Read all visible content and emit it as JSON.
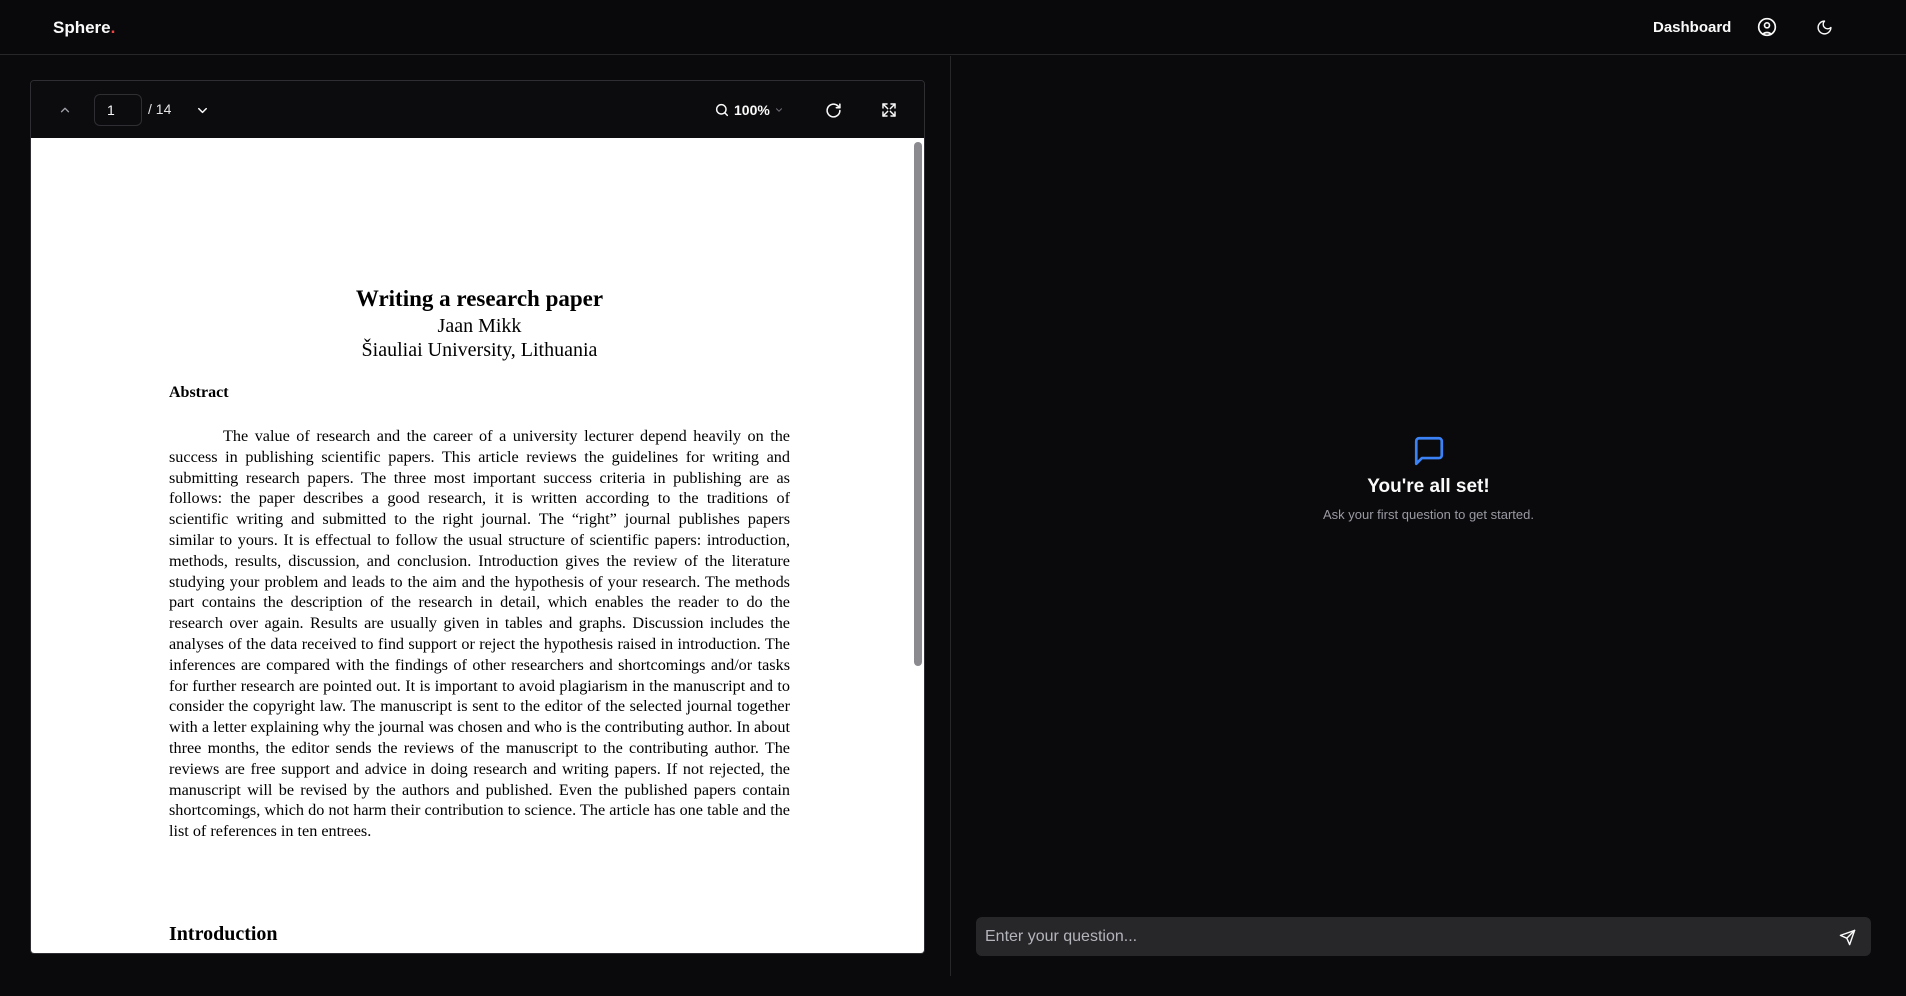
{
  "header": {
    "logo_text": "Sphere",
    "logo_dot": ".",
    "nav_dashboard": "Dashboard",
    "icons": [
      "user-circle-icon",
      "moon-icon"
    ]
  },
  "viewer": {
    "page_current": "1",
    "page_total": "/ 14",
    "zoom": "100%",
    "icons": [
      "chevron-up-icon",
      "chevron-down-icon",
      "search-icon",
      "zoom-dropdown-icon",
      "refresh-icon",
      "fullscreen-icon"
    ],
    "document": {
      "title": "Writing a research paper",
      "author": "Jaan Mikk",
      "affiliation": "Šiauliai University, Lithuania",
      "abstract_heading": "Abstract",
      "abstract_text": "The value of research and the career of a university lecturer depend heavily on the success in publishing scientific papers. This article reviews the guidelines for writing and submitting research papers. The three most important success criteria in publishing are as follows: the paper describes a good research, it is written according to the traditions of scientific writing and submitted to the right journal. The “right” journal publishes papers similar to yours. It is effectual to follow the usual structure of scientific papers: introduction, methods, results, discussion, and conclusion. Introduction gives the review of the literature studying your problem and leads to the aim and the hypothesis of your research. The methods part contains the description of the research in detail, which enables the reader to do the research over again. Results are usually given in tables and graphs. Discussion includes the analyses of the data received to find support or reject the hypothesis raised in introduction. The inferences are compared with the findings of other researchers and shortcomings and/or tasks for further research are pointed out. It is important to avoid plagiarism in the manuscript and to consider the copyright law. The manuscript is sent to the editor of the selected journal together with a letter explaining why the journal was chosen and who is the contributing author. In about three months, the editor sends the reviews of the manuscript to the contributing author. The reviews are free support and advice in doing research and writing papers. If not rejected, the manuscript will be revised by the authors and published. Even the published papers contain shortcomings, which do not harm their contribution to science. The article has one table and the list of references in ten entrees.",
      "intro_heading": "Introduction"
    }
  },
  "chat": {
    "empty_title": "You're all set!",
    "empty_subtitle": "Ask your first question to get started.",
    "input_placeholder": "Enter your question...",
    "icons": [
      "message-square-icon",
      "send-icon"
    ]
  },
  "colors": {
    "background": "#0a0a0c",
    "accent": "#3b82f6",
    "logo_dot": "#ef4444",
    "input_bg": "#27272a"
  }
}
